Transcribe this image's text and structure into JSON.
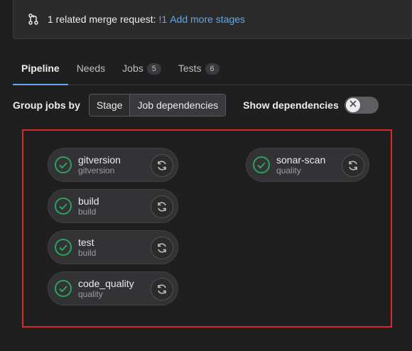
{
  "merge_request": {
    "text": "1 related merge request:",
    "link": "!1",
    "add_stages": "Add more stages"
  },
  "tabs": [
    {
      "label": "Pipeline",
      "active": true
    },
    {
      "label": "Needs"
    },
    {
      "label": "Jobs",
      "count": "5"
    },
    {
      "label": "Tests",
      "count": "6"
    }
  ],
  "controls": {
    "group_label": "Group jobs by",
    "stage_btn": "Stage",
    "deps_btn": "Job dependencies",
    "show_deps": "Show dependencies",
    "show_deps_on": false
  },
  "jobs": [
    {
      "name": "gitversion",
      "stage": "gitversion",
      "status": "passed"
    },
    {
      "name": "build",
      "stage": "build",
      "status": "passed"
    },
    {
      "name": "test",
      "stage": "build",
      "status": "passed"
    },
    {
      "name": "code_quality",
      "stage": "quality",
      "status": "passed"
    },
    {
      "name": "sonar-scan",
      "stage": "quality",
      "status": "passed"
    }
  ],
  "colors": {
    "success": "#2da160",
    "link": "#63a6e9",
    "highlight_frame": "#d62a2a"
  }
}
